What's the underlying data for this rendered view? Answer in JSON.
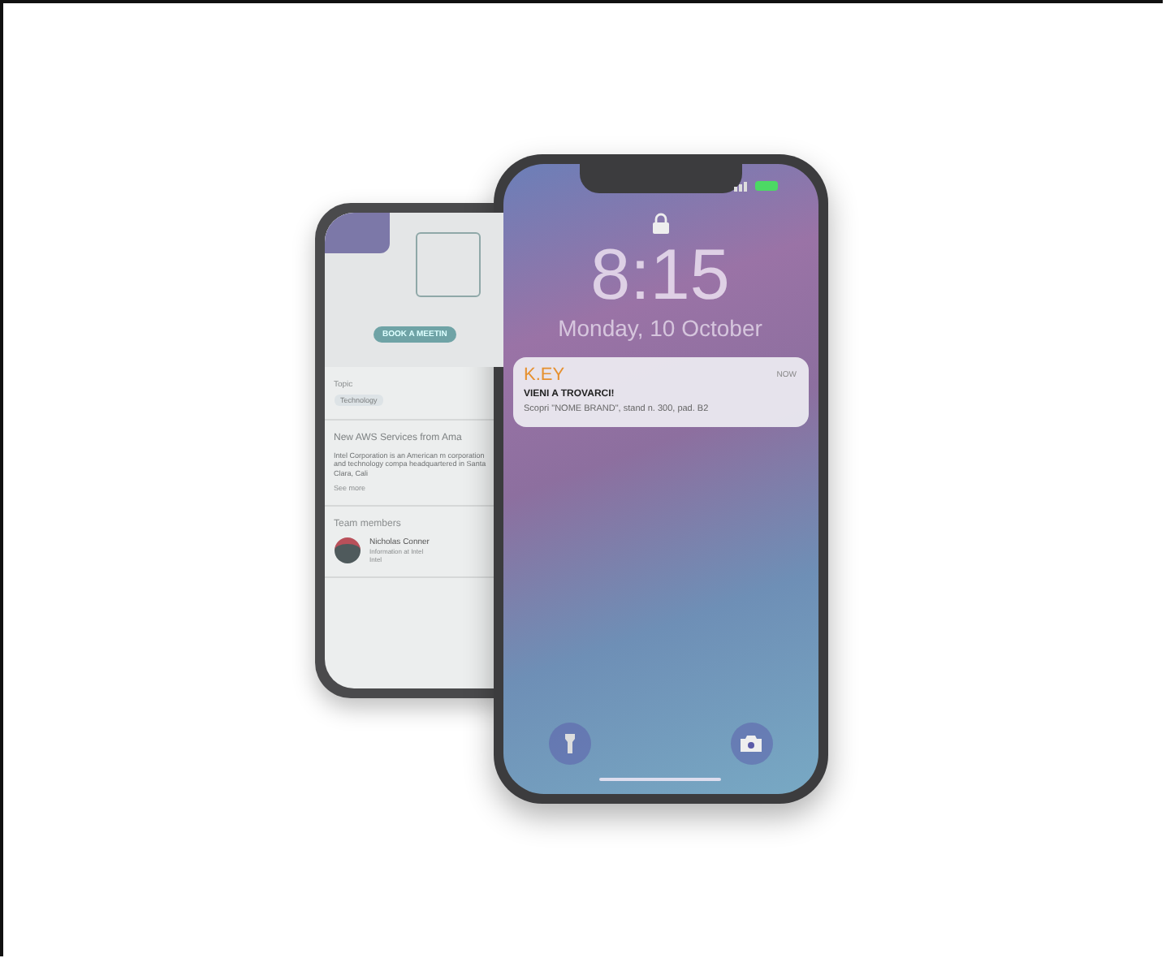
{
  "back_phone": {
    "button": "BOOK A MEETIN",
    "topic_heading": "Topic",
    "topic_tag": "Technology",
    "article_title": "New AWS Services from Ama",
    "article_text": "Intel Corporation is an American m corporation and technology compa headquartered in Santa Clara, Cali",
    "see_more": "See more",
    "team_heading": "Team members",
    "members": [
      {
        "name": "Nicholas Conner",
        "role": "Information at Intel",
        "company": "Intel"
      }
    ]
  },
  "lock_screen": {
    "time": "8:15",
    "date": "Monday, 10 October",
    "notification": {
      "app": "K.EY",
      "when": "NOW",
      "title": "VIENI A TROVARCI!",
      "body": "Scopri \"NOME BRAND\", stand n. 300, pad. B2"
    }
  }
}
